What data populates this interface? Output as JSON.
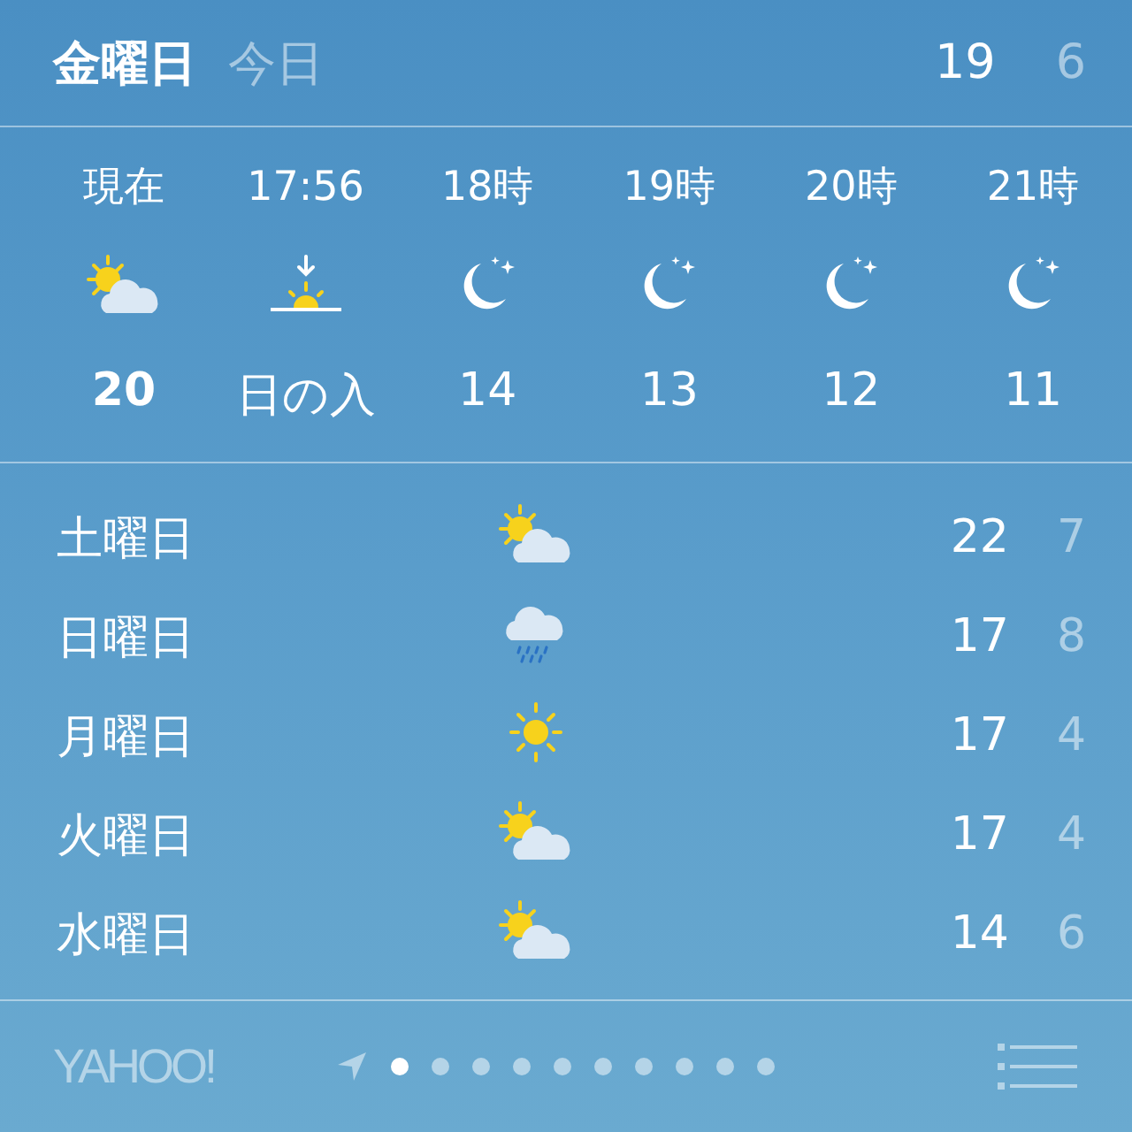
{
  "header": {
    "day": "金曜日",
    "label": "今日",
    "high": "19",
    "low": "6"
  },
  "hourly": [
    {
      "time": "現在",
      "kind": "partly-cloudy",
      "temp": "20",
      "current": true
    },
    {
      "time": "17:56",
      "kind": "sunset",
      "temp": "日の入",
      "current": false
    },
    {
      "time": "18時",
      "kind": "moon",
      "temp": "14",
      "current": false
    },
    {
      "time": "19時",
      "kind": "moon",
      "temp": "13",
      "current": false
    },
    {
      "time": "20時",
      "kind": "moon",
      "temp": "12",
      "current": false
    },
    {
      "time": "21時",
      "kind": "moon",
      "temp": "11",
      "current": false
    }
  ],
  "daily": [
    {
      "day": "土曜日",
      "kind": "partly-cloudy",
      "high": "22",
      "low": "7"
    },
    {
      "day": "日曜日",
      "kind": "rain",
      "high": "17",
      "low": "8"
    },
    {
      "day": "月曜日",
      "kind": "sun",
      "high": "17",
      "low": "4"
    },
    {
      "day": "火曜日",
      "kind": "partly-cloudy",
      "high": "17",
      "low": "4"
    },
    {
      "day": "水曜日",
      "kind": "partly-cloudy",
      "high": "14",
      "low": "6"
    }
  ],
  "footer": {
    "logo": "YAHOO!",
    "pages": [
      {
        "selected": false,
        "kind": "location"
      },
      {
        "selected": true
      },
      {
        "selected": false
      },
      {
        "selected": false
      },
      {
        "selected": false
      },
      {
        "selected": false
      },
      {
        "selected": false
      },
      {
        "selected": false
      },
      {
        "selected": false
      },
      {
        "selected": false
      },
      {
        "selected": false
      }
    ]
  }
}
